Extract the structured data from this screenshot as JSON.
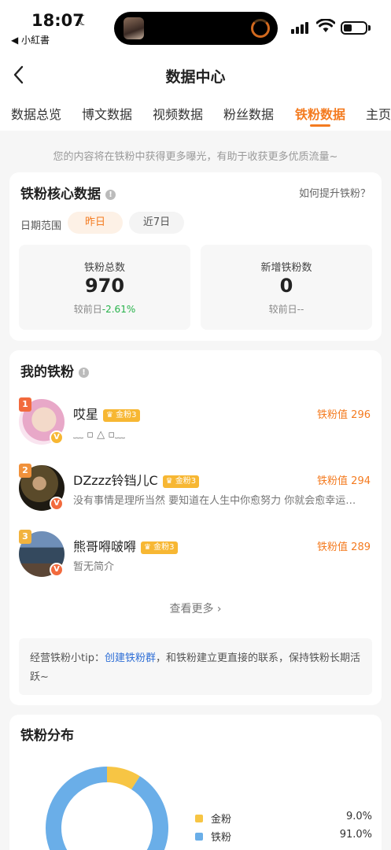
{
  "status_bar": {
    "time": "18:07",
    "back_app": "◀ 小紅書"
  },
  "nav": {
    "title": "数据中心"
  },
  "tabs": [
    {
      "label": "数据总览"
    },
    {
      "label": "博文数据"
    },
    {
      "label": "视频数据"
    },
    {
      "label": "粉丝数据"
    },
    {
      "label": "铁粉数据",
      "active": true
    },
    {
      "label": "主页"
    }
  ],
  "hint": "您的内容将在铁粉中获得更多曝光，有助于收获更多优质流量~",
  "core": {
    "title": "铁粉核心数据",
    "help_link": "如何提升铁粉？",
    "date_label": "日期范围",
    "date_options": [
      "昨日",
      "近7日"
    ],
    "stats": [
      {
        "label": "铁粉总数",
        "value": "970",
        "compare_prefix": "较前日",
        "compare_value": "-2.61%"
      },
      {
        "label": "新增铁粉数",
        "value": "0",
        "compare_prefix": "较前日",
        "compare_value": "--"
      }
    ]
  },
  "my_fans": {
    "title": "我的铁粉",
    "items": [
      {
        "rank": "1",
        "name": "哎星",
        "level": "金粉3",
        "bio": "﹏ ▫ △ ▫﹏",
        "score": "铁粉值 296"
      },
      {
        "rank": "2",
        "name": "DZzzz铃铛儿C",
        "level": "金粉3",
        "bio": "没有事情是理所当然 要知道在人生中你愈努力 你就会愈幸运…",
        "score": "铁粉值 294"
      },
      {
        "rank": "3",
        "name": "熊哥嘚啵嘚",
        "level": "金粉3",
        "bio": "暂无简介",
        "score": "铁粉值 289"
      }
    ],
    "see_more": "查看更多 ›",
    "tip_prefix": "经营铁粉小tip：",
    "tip_link": "创建铁粉群",
    "tip_suffix": "，和铁粉建立更直接的联系，保持铁粉长期活跃~"
  },
  "distribution": {
    "title": "铁粉分布"
  },
  "chart_data": {
    "type": "pie",
    "categories": [
      "金粉",
      "铁粉"
    ],
    "values": [
      9.0,
      91.0
    ],
    "labels": [
      "9.0%",
      "91.0%"
    ],
    "colors": [
      "#f7c544",
      "#6aaee8"
    ]
  },
  "colors": {
    "accent": "#f47b20",
    "green": "#27b24a",
    "link": "#2f6fd6"
  }
}
